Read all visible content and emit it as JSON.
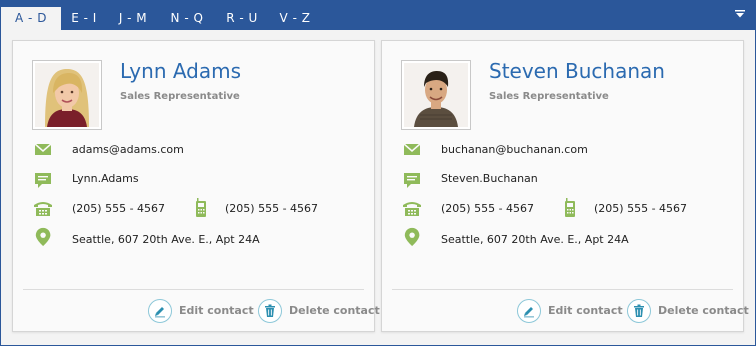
{
  "tabs": [
    {
      "label": "A - D",
      "active": true
    },
    {
      "label": "E - I",
      "active": false
    },
    {
      "label": "J - M",
      "active": false
    },
    {
      "label": "N - Q",
      "active": false
    },
    {
      "label": "R - U",
      "active": false
    },
    {
      "label": "V - Z",
      "active": false
    }
  ],
  "colors": {
    "accent": "#2b579a",
    "name": "#2b6ab0",
    "icon_green": "#8fba5a",
    "action_ring": "#8cc7d8",
    "action_icon": "#2c8fb0"
  },
  "contacts": [
    {
      "name": "Lynn Adams",
      "title": "Sales Representative",
      "email": "adams@adams.com",
      "im": "Lynn.Adams",
      "phone": "(205) 555 - 4567",
      "mobile": "(205) 555 - 4567",
      "address": "Seattle, 607 20th Ave. E., Apt 24A",
      "edit_label": "Edit contact",
      "delete_label": "Delete contact"
    },
    {
      "name": "Steven Buchanan",
      "title": "Sales Representative",
      "email": "buchanan@buchanan.com",
      "im": "Steven.Buchanan",
      "phone": "(205) 555 - 4567",
      "mobile": "(205) 555 - 4567",
      "address": "Seattle, 607 20th Ave. E., Apt 24A",
      "edit_label": "Edit contact",
      "delete_label": "Delete contact"
    }
  ]
}
